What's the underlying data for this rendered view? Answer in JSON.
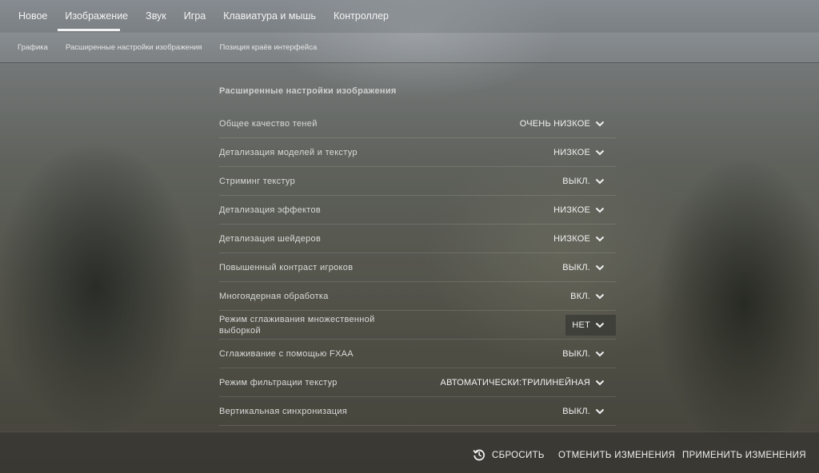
{
  "top_tabs": [
    {
      "label": "Новое"
    },
    {
      "label": "Изображение"
    },
    {
      "label": "Звук"
    },
    {
      "label": "Игра"
    },
    {
      "label": "Клавиатура и мышь"
    },
    {
      "label": "Контроллер"
    }
  ],
  "active_top_tab": "Изображение",
  "sub_tabs": [
    {
      "label": "Графика"
    },
    {
      "label": "Расширенные настройки изображения"
    },
    {
      "label": "Позиция краёв интерфейса"
    }
  ],
  "section": {
    "title": "Расширенные настройки изображения",
    "rows": [
      {
        "label": "Общее качество теней",
        "value": "ОЧЕНЬ НИЗКОЕ"
      },
      {
        "label": "Детализация моделей и текстур",
        "value": "НИЗКОЕ"
      },
      {
        "label": "Стриминг текстур",
        "value": "ВЫКЛ."
      },
      {
        "label": "Детализация эффектов",
        "value": "НИЗКОЕ"
      },
      {
        "label": "Детализация шейдеров",
        "value": "НИЗКОЕ"
      },
      {
        "label": "Повышенный контраст игроков",
        "value": "ВЫКЛ."
      },
      {
        "label": "Многоядерная обработка",
        "value": "ВКЛ."
      },
      {
        "label": "Режим сглаживания множественной выборкой",
        "value": "НЕТ"
      },
      {
        "label": "Сглаживание с помощью FXAA",
        "value": "ВЫКЛ."
      },
      {
        "label": "Режим фильтрации текстур",
        "value": "АВТОМАТИЧЕСКИ:ТРИЛИНЕЙНАЯ"
      },
      {
        "label": "Вертикальная синхронизация",
        "value": "ВЫКЛ."
      }
    ]
  },
  "footer": {
    "reset_label": "СБРОСИТЬ",
    "cancel_label": "ОТМЕНИТЬ ИЗМЕНЕНИЯ",
    "apply_label": "ПРИМЕНИТЬ ИЗМЕНЕНИЯ",
    "reset_icon": "history-reset-icon"
  },
  "colors": {
    "text": "#e8e8e8",
    "underline": "#f2f2f2"
  }
}
